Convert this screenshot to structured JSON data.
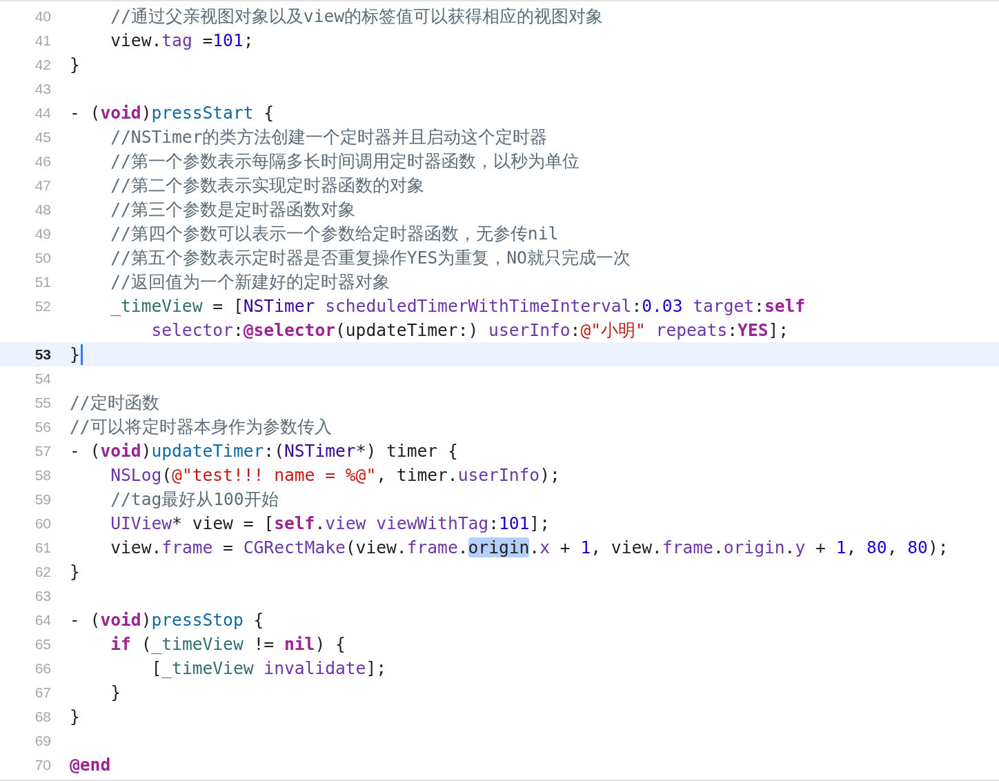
{
  "editor": {
    "lines": [
      {
        "number": "40",
        "current": false,
        "tokens": [
          {
            "text": "    //通过父亲视图对象以及view的标签值可以获得相应的视图对象",
            "kind": "comment"
          }
        ]
      },
      {
        "number": "41",
        "current": false,
        "tokens": [
          {
            "text": "    view.",
            "kind": "plain"
          },
          {
            "text": "tag",
            "kind": "member"
          },
          {
            "text": " =",
            "kind": "plain"
          },
          {
            "text": "101",
            "kind": "number"
          },
          {
            "text": ";",
            "kind": "plain"
          }
        ]
      },
      {
        "number": "42",
        "current": false,
        "tokens": [
          {
            "text": "}",
            "kind": "plain"
          }
        ]
      },
      {
        "number": "43",
        "current": false
      },
      {
        "number": "44",
        "current": false,
        "tokens": [
          {
            "text": "- (",
            "kind": "plain"
          },
          {
            "text": "void",
            "kind": "keyword"
          },
          {
            "text": ")",
            "kind": "plain"
          },
          {
            "text": "pressStart",
            "kind": "declaration"
          },
          {
            "text": " {",
            "kind": "plain"
          }
        ]
      },
      {
        "number": "45",
        "current": false,
        "tokens": [
          {
            "text": "    //NSTimer的类方法创建一个定时器并且启动这个定时器",
            "kind": "comment"
          }
        ]
      },
      {
        "number": "46",
        "current": false,
        "tokens": [
          {
            "text": "    //第一个参数表示每隔多长时间调用定时器函数，以秒为单位",
            "kind": "comment"
          }
        ]
      },
      {
        "number": "47",
        "current": false,
        "tokens": [
          {
            "text": "    //第二个参数表示实现定时器函数的对象",
            "kind": "comment"
          }
        ]
      },
      {
        "number": "48",
        "current": false,
        "tokens": [
          {
            "text": "    //第三个参数是定时器函数对象",
            "kind": "comment"
          }
        ]
      },
      {
        "number": "49",
        "current": false,
        "tokens": [
          {
            "text": "    //第四个参数可以表示一个参数给定时器函数，无参传nil",
            "kind": "comment"
          }
        ]
      },
      {
        "number": "50",
        "current": false,
        "tokens": [
          {
            "text": "    //第五个参数表示定时器是否重复操作YES为重复，NO就只完成一次",
            "kind": "comment"
          }
        ]
      },
      {
        "number": "51",
        "current": false,
        "tokens": [
          {
            "text": "    //返回值为一个新建好的定时器对象",
            "kind": "comment"
          }
        ]
      },
      {
        "number": "52",
        "current": false,
        "tokens": [
          {
            "text": "    _timeView",
            "kind": "ivar"
          },
          {
            "text": " = [",
            "kind": "plain"
          },
          {
            "text": "NSTimer",
            "kind": "type"
          },
          {
            "text": " scheduledTimerWithTimeInterval",
            "kind": "member"
          },
          {
            "text": ":",
            "kind": "plain"
          },
          {
            "text": "0.03",
            "kind": "number"
          },
          {
            "text": " target",
            "kind": "member"
          },
          {
            "text": ":",
            "kind": "plain"
          },
          {
            "text": "self",
            "kind": "keyword"
          }
        ],
        "wrapped": [
          {
            "text": "        selector",
            "kind": "member"
          },
          {
            "text": ":",
            "kind": "plain"
          },
          {
            "text": "@selector",
            "kind": "keyword"
          },
          {
            "text": "(updateTimer:) ",
            "kind": "plain"
          },
          {
            "text": "userInfo",
            "kind": "member"
          },
          {
            "text": ":",
            "kind": "plain"
          },
          {
            "text": "@\"小明\"",
            "kind": "string"
          },
          {
            "text": " repeats",
            "kind": "member"
          },
          {
            "text": ":",
            "kind": "plain"
          },
          {
            "text": "YES",
            "kind": "keyword"
          },
          {
            "text": "];",
            "kind": "plain"
          }
        ]
      },
      {
        "number": "53",
        "current": true,
        "tokens": [
          {
            "text": "}",
            "kind": "plain"
          }
        ]
      },
      {
        "number": "54",
        "current": false
      },
      {
        "number": "55",
        "current": false,
        "tokens": [
          {
            "text": "//定时函数",
            "kind": "comment"
          }
        ]
      },
      {
        "number": "56",
        "current": false,
        "tokens": [
          {
            "text": "//可以将定时器本身作为参数传入",
            "kind": "comment"
          }
        ]
      },
      {
        "number": "57",
        "current": false,
        "tokens": [
          {
            "text": "- (",
            "kind": "plain"
          },
          {
            "text": "void",
            "kind": "keyword"
          },
          {
            "text": ")",
            "kind": "plain"
          },
          {
            "text": "updateTimer",
            "kind": "declaration"
          },
          {
            "text": ":(",
            "kind": "plain"
          },
          {
            "text": "NSTimer",
            "kind": "type"
          },
          {
            "text": "*) timer {",
            "kind": "plain"
          }
        ]
      },
      {
        "number": "58",
        "current": false,
        "tokens": [
          {
            "text": "    NSLog",
            "kind": "member"
          },
          {
            "text": "(",
            "kind": "plain"
          },
          {
            "text": "@\"test!!! name = %@\"",
            "kind": "string"
          },
          {
            "text": ", timer.",
            "kind": "plain"
          },
          {
            "text": "userInfo",
            "kind": "member"
          },
          {
            "text": ");",
            "kind": "plain"
          }
        ]
      },
      {
        "number": "59",
        "current": false,
        "tokens": [
          {
            "text": "    //tag最好从100开始",
            "kind": "comment"
          }
        ]
      },
      {
        "number": "60",
        "current": false,
        "tokens": [
          {
            "text": "    UIView",
            "kind": "member"
          },
          {
            "text": "* view = [",
            "kind": "plain"
          },
          {
            "text": "self",
            "kind": "keyword"
          },
          {
            "text": ".",
            "kind": "plain"
          },
          {
            "text": "view",
            "kind": "member"
          },
          {
            "text": " viewWithTag",
            "kind": "member"
          },
          {
            "text": ":",
            "kind": "plain"
          },
          {
            "text": "101",
            "kind": "number"
          },
          {
            "text": "];",
            "kind": "plain"
          }
        ]
      },
      {
        "number": "61",
        "current": false,
        "tokens": [
          {
            "text": "    view.",
            "kind": "plain"
          },
          {
            "text": "frame",
            "kind": "member"
          },
          {
            "text": " = ",
            "kind": "plain"
          },
          {
            "text": "CGRectMake",
            "kind": "member"
          },
          {
            "text": "(view.",
            "kind": "plain"
          },
          {
            "text": "frame",
            "kind": "member"
          },
          {
            "text": ".",
            "kind": "plain"
          },
          {
            "text": "origin",
            "kind": "plain",
            "selected": true
          },
          {
            "text": ".",
            "kind": "plain"
          },
          {
            "text": "x",
            "kind": "member"
          },
          {
            "text": " + ",
            "kind": "plain"
          },
          {
            "text": "1",
            "kind": "number"
          },
          {
            "text": ", view.",
            "kind": "plain"
          },
          {
            "text": "frame",
            "kind": "member"
          },
          {
            "text": ".",
            "kind": "plain"
          },
          {
            "text": "origin",
            "kind": "member"
          },
          {
            "text": ".",
            "kind": "plain"
          },
          {
            "text": "y",
            "kind": "member"
          },
          {
            "text": " + ",
            "kind": "plain"
          },
          {
            "text": "1",
            "kind": "number"
          },
          {
            "text": ", ",
            "kind": "plain"
          },
          {
            "text": "80",
            "kind": "number"
          },
          {
            "text": ", ",
            "kind": "plain"
          },
          {
            "text": "80",
            "kind": "number"
          },
          {
            "text": ");",
            "kind": "plain"
          }
        ]
      },
      {
        "number": "62",
        "current": false,
        "tokens": [
          {
            "text": "}",
            "kind": "plain"
          }
        ]
      },
      {
        "number": "63",
        "current": false
      },
      {
        "number": "64",
        "current": false,
        "tokens": [
          {
            "text": "- (",
            "kind": "plain"
          },
          {
            "text": "void",
            "kind": "keyword"
          },
          {
            "text": ")",
            "kind": "plain"
          },
          {
            "text": "pressStop",
            "kind": "declaration"
          },
          {
            "text": " {",
            "kind": "plain"
          }
        ]
      },
      {
        "number": "65",
        "current": false,
        "tokens": [
          {
            "text": "    if",
            "kind": "keyword"
          },
          {
            "text": " (",
            "kind": "plain"
          },
          {
            "text": "_timeView",
            "kind": "ivar"
          },
          {
            "text": " != ",
            "kind": "plain"
          },
          {
            "text": "nil",
            "kind": "keyword"
          },
          {
            "text": ") {",
            "kind": "plain"
          }
        ]
      },
      {
        "number": "66",
        "current": false,
        "tokens": [
          {
            "text": "        [",
            "kind": "plain"
          },
          {
            "text": "_timeView",
            "kind": "ivar"
          },
          {
            "text": " invalidate",
            "kind": "member"
          },
          {
            "text": "];",
            "kind": "plain"
          }
        ]
      },
      {
        "number": "67",
        "current": false,
        "tokens": [
          {
            "text": "    }",
            "kind": "plain"
          }
        ]
      },
      {
        "number": "68",
        "current": false,
        "tokens": [
          {
            "text": "}",
            "kind": "plain"
          }
        ]
      },
      {
        "number": "69",
        "current": false
      },
      {
        "number": "70",
        "current": false,
        "tokens": [
          {
            "text": "@end",
            "kind": "keyword"
          }
        ]
      }
    ]
  }
}
